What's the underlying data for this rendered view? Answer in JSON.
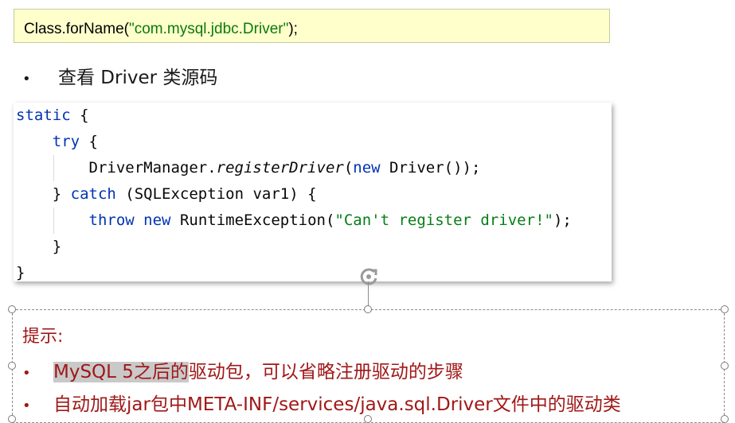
{
  "code_snippet": {
    "prefix": "Class.forName(",
    "string": "\"com.mysql.jdbc.Driver\"",
    "suffix": ");"
  },
  "bullet": {
    "marker": "•",
    "text": "查看 Driver 类源码"
  },
  "source": {
    "l1_kw": "static",
    "l1_rest": " {",
    "l2_kw": "try",
    "l2_rest": " {",
    "l3_a": "DriverManager.",
    "l3_method": "registerDriver",
    "l3_b": "(",
    "l3_kw": "new",
    "l3_c": " Driver());",
    "l4_a": "} ",
    "l4_kw": "catch",
    "l4_b": " (SQLException var1) {",
    "l5_kw1": "throw",
    "l5_sp": " ",
    "l5_kw2": "new",
    "l5_a": " RuntimeException(",
    "l5_str": "\"Can't register driver!\"",
    "l5_b": ");",
    "l6": "}",
    "l7": "}"
  },
  "tip": {
    "title": "提示:",
    "item1_highlight": "MySQL 5之后的",
    "item1_rest": "驱动包，可以省略注册驱动的步骤",
    "item2": "自动加载jar包中META-INF/services/java.sql.Driver文件中的驱动类",
    "marker": "•"
  },
  "colors": {
    "tip_text": "#a01818",
    "keyword": "#0033b3",
    "string": "#067d17",
    "code_bg": "#ffffcc"
  }
}
